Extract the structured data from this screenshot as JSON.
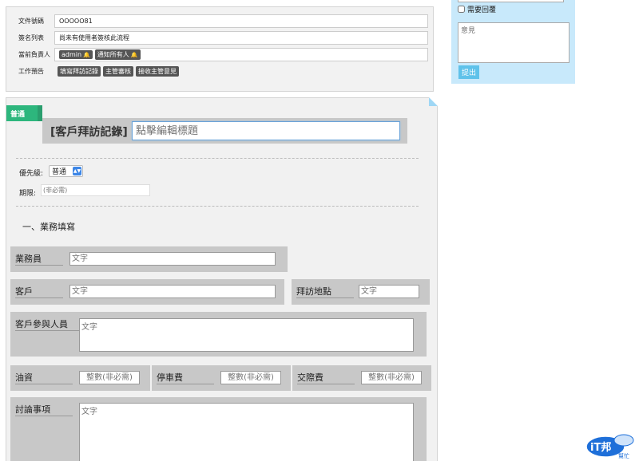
{
  "info": {
    "rows": [
      {
        "label": "文件號碼",
        "value": "OOOOO81"
      },
      {
        "label": "簽名列表",
        "value": "尚未有使用者簽核此流程"
      },
      {
        "label": "當前負責人",
        "chips": [
          "admin",
          "通知所有人"
        ]
      },
      {
        "label": "工作預告",
        "chips": [
          "填寫拜訪記錄",
          "主管審核",
          "接收主管意見"
        ]
      }
    ]
  },
  "reply": {
    "need_reply_label": "需要回覆",
    "opinion_placeholder": "意見",
    "submit_label": "提出"
  },
  "form": {
    "priority_tag": "普通",
    "title_prefix": "[客戶拜訪記錄]",
    "title_placeholder": "點擊編輯標題",
    "priority_label": "優先級:",
    "priority_value": "普通",
    "deadline_label": "期限:",
    "deadline_placeholder": "(非必需)",
    "section_heading": "一、業務填寫",
    "fields": {
      "salesperson": {
        "label": "業務員",
        "placeholder": "文字"
      },
      "customer": {
        "label": "客戶",
        "placeholder": "文字"
      },
      "visit_location": {
        "label": "拜訪地點",
        "placeholder": "文字"
      },
      "customer_attendees": {
        "label": "客戶參與人員",
        "placeholder": "文字"
      },
      "fuel": {
        "label": "油資",
        "placeholder": "整數(非必需)"
      },
      "parking": {
        "label": "停車費",
        "placeholder": "整數(非必需)"
      },
      "entertainment": {
        "label": "交際費",
        "placeholder": "整數(非必需)"
      },
      "discussion": {
        "label": "討論事項",
        "placeholder": "文字"
      }
    }
  },
  "logo": {
    "main": "iT邦",
    "sub": "幫忙"
  },
  "colors": {
    "accent_green": "#2db67d",
    "reply_bg": "#c8e9fb",
    "submit_blue": "#5fc2ea",
    "title_focus": "#6aa2d8",
    "logo_blue": "#1e6fd9"
  }
}
